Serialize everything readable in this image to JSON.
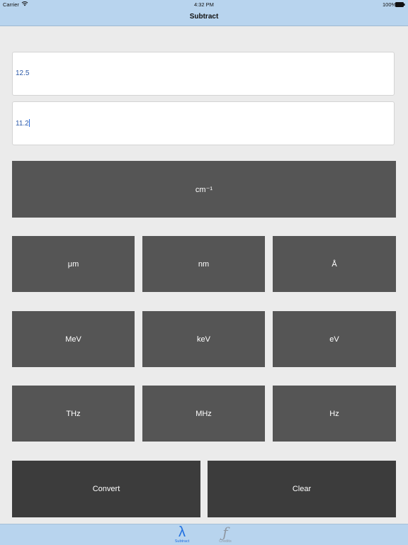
{
  "status": {
    "carrier": "Carrier",
    "wifi_icon": "wifi-icon",
    "time": "4:32 PM",
    "battery": "100%"
  },
  "nav": {
    "title": "Subtract"
  },
  "inputs": {
    "first_value": "12.5",
    "second_value": "11.2"
  },
  "units": {
    "wavenumber": "cm⁻¹",
    "row1": [
      "μm",
      "nm",
      "Å"
    ],
    "row2": [
      "MeV",
      "keV",
      "eV"
    ],
    "row3": [
      "THz",
      "MHz",
      "Hz"
    ]
  },
  "actions": {
    "convert": "Convert",
    "clear": "Clear"
  },
  "tabs": [
    {
      "glyph": "λ",
      "label": "Subtract",
      "icon": "lambda-icon",
      "active": true
    },
    {
      "glyph": "ƒ",
      "label": "Credits",
      "icon": "function-icon",
      "active": false
    }
  ],
  "colors": {
    "bar": "#b8d4ee",
    "button": "#555555",
    "action_button": "#3c3c3c",
    "accent": "#1f6fe0"
  }
}
